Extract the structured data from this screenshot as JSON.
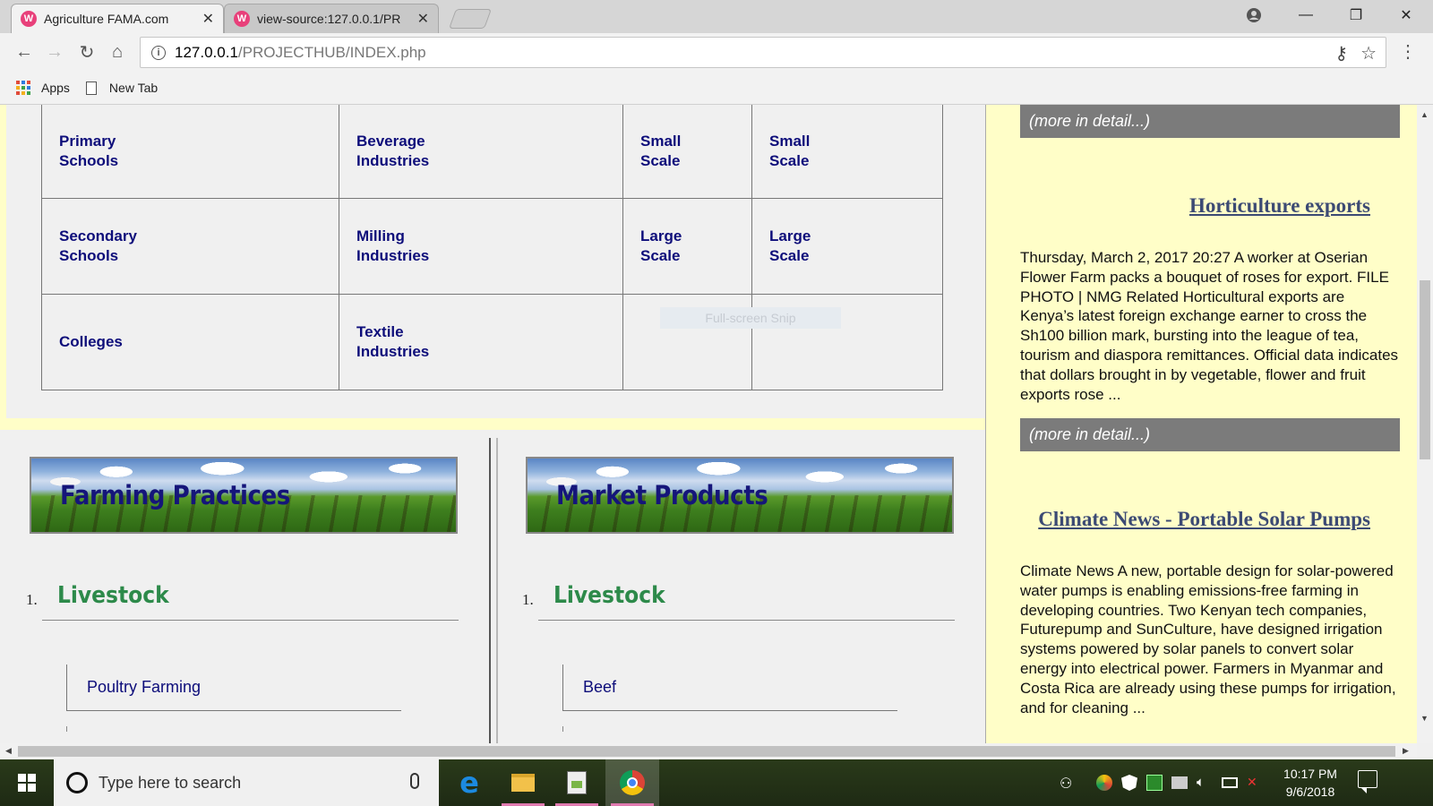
{
  "browser": {
    "tabs": [
      {
        "title": "Agriculture FAMA.com",
        "favicon": "W",
        "active": true
      },
      {
        "title": "view-source:127.0.0.1/PR",
        "favicon": "W",
        "active": false
      }
    ],
    "url_host": "127.0.0.1",
    "url_path": "/PROJECTHUB/INDEX.php",
    "bookmarks": [
      {
        "label": "Apps",
        "icon": "apps-grid-icon"
      },
      {
        "label": "New Tab",
        "icon": "page-icon"
      }
    ]
  },
  "school_table": {
    "rows": [
      [
        "Primary Schools",
        "Beverage Industries",
        "Small Scale",
        "Small Scale"
      ],
      [
        "Secondary Schools",
        "Milling Industries",
        "Large Scale",
        "Large Scale"
      ],
      [
        "Colleges",
        "Textile Industries",
        "",
        ""
      ]
    ]
  },
  "snip_overlay": "Full-screen Snip",
  "farming": {
    "banner_title": "Farming Practices",
    "list_number": "1.",
    "category": "Livestock",
    "sub_item": "Poultry Farming"
  },
  "market": {
    "banner_title": "Market Products",
    "list_number": "1.",
    "category": "Livestock",
    "sub_item": "Beef"
  },
  "news": {
    "more_label": "(more in detail...)",
    "articles": [
      {
        "title": "Horticulture exports",
        "body": "Thursday, March 2, 2017 20:27 A worker at Oserian Flower Farm packs a bouquet of roses for export. FILE PHOTO | NMG Related Horticultural exports are Kenya’s latest foreign exchange earner to cross the Sh100 billion mark, bursting into the league of tea, tourism and diaspora remittances. Official data indicates that dollars brought in by vegetable, flower and fruit exports rose ...",
        "more_label": "(more in detail...)"
      },
      {
        "title": "Climate News - Portable Solar Pumps",
        "body": "Climate News A new, portable design for solar-powered water pumps is enabling emissions-free farming in developing countries. Two Kenyan tech companies, Futurepump and SunCulture, have designed irrigation systems powered by solar panels to convert solar energy into electrical power. Farmers in Myanmar and Costa Rica are already using these pumps for irrigation, and for cleaning ..."
      }
    ]
  },
  "taskbar": {
    "search_placeholder": "Type here to search",
    "time": "10:17 PM",
    "date": "9/6/2018"
  }
}
